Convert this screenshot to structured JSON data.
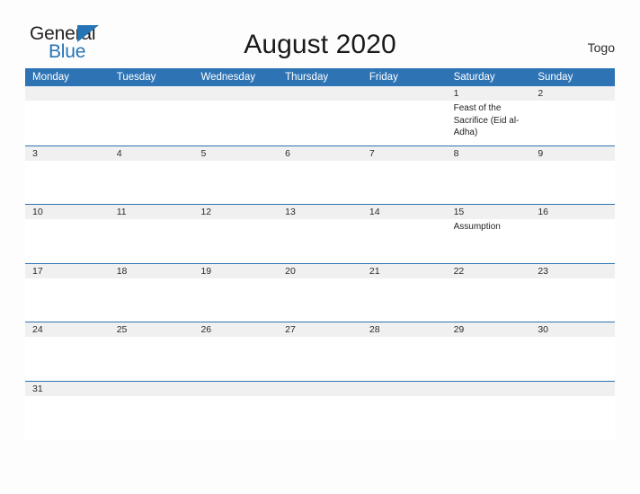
{
  "logo": {
    "word1": "General",
    "word2": "Blue",
    "accent_color": "#2574b5",
    "triangle_icon": "triangle-icon"
  },
  "header": {
    "title": "August 2020",
    "country": "Togo"
  },
  "calendar": {
    "header_bg": "#2e74b5",
    "daynum_bg": "#f0f0f0",
    "weekdays": [
      "Monday",
      "Tuesday",
      "Wednesday",
      "Thursday",
      "Friday",
      "Saturday",
      "Sunday"
    ],
    "weeks": [
      {
        "days": [
          {
            "num": "",
            "event": ""
          },
          {
            "num": "",
            "event": ""
          },
          {
            "num": "",
            "event": ""
          },
          {
            "num": "",
            "event": ""
          },
          {
            "num": "",
            "event": ""
          },
          {
            "num": "1",
            "event": "Feast of the Sacrifice (Eid al-Adha)"
          },
          {
            "num": "2",
            "event": ""
          }
        ]
      },
      {
        "days": [
          {
            "num": "3",
            "event": ""
          },
          {
            "num": "4",
            "event": ""
          },
          {
            "num": "5",
            "event": ""
          },
          {
            "num": "6",
            "event": ""
          },
          {
            "num": "7",
            "event": ""
          },
          {
            "num": "8",
            "event": ""
          },
          {
            "num": "9",
            "event": ""
          }
        ]
      },
      {
        "days": [
          {
            "num": "10",
            "event": ""
          },
          {
            "num": "11",
            "event": ""
          },
          {
            "num": "12",
            "event": ""
          },
          {
            "num": "13",
            "event": ""
          },
          {
            "num": "14",
            "event": ""
          },
          {
            "num": "15",
            "event": "Assumption"
          },
          {
            "num": "16",
            "event": ""
          }
        ]
      },
      {
        "days": [
          {
            "num": "17",
            "event": ""
          },
          {
            "num": "18",
            "event": ""
          },
          {
            "num": "19",
            "event": ""
          },
          {
            "num": "20",
            "event": ""
          },
          {
            "num": "21",
            "event": ""
          },
          {
            "num": "22",
            "event": ""
          },
          {
            "num": "23",
            "event": ""
          }
        ]
      },
      {
        "days": [
          {
            "num": "24",
            "event": ""
          },
          {
            "num": "25",
            "event": ""
          },
          {
            "num": "26",
            "event": ""
          },
          {
            "num": "27",
            "event": ""
          },
          {
            "num": "28",
            "event": ""
          },
          {
            "num": "29",
            "event": ""
          },
          {
            "num": "30",
            "event": ""
          }
        ]
      },
      {
        "days": [
          {
            "num": "31",
            "event": ""
          },
          {
            "num": "",
            "event": ""
          },
          {
            "num": "",
            "event": ""
          },
          {
            "num": "",
            "event": ""
          },
          {
            "num": "",
            "event": ""
          },
          {
            "num": "",
            "event": ""
          },
          {
            "num": "",
            "event": ""
          }
        ]
      }
    ]
  }
}
